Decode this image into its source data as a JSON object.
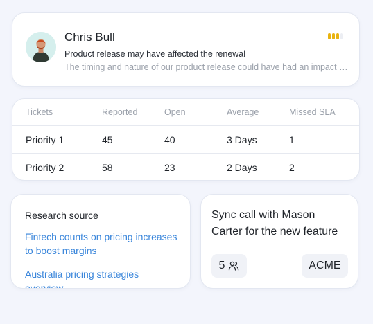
{
  "person": {
    "name": "Chris Bull",
    "note_title": "Product release may have affected the renewal",
    "note_body": "The timing and nature of our product release could have had an impact on the renewal",
    "signal_level": 3,
    "signal_max": 4,
    "signal_color": "#e9b30f",
    "avatar_icon": "avatar-photo"
  },
  "tickets": {
    "headers": [
      "Tickets",
      "Reported",
      "Open",
      "Average",
      "Missed SLA"
    ],
    "rows": [
      [
        "Priority 1",
        "45",
        "40",
        "3 Days",
        "1"
      ],
      [
        "Priority 2",
        "58",
        "23",
        "2 Days",
        "2"
      ]
    ]
  },
  "research": {
    "title": "Research source",
    "links": [
      "Fintech counts on pricing increases to boost margins",
      "Australia pricing strategies overview"
    ],
    "link_color": "#3a86db"
  },
  "meeting": {
    "title_line1": "Sync call with Mason",
    "title_line2": "Carter for the new feature",
    "attendees": "5",
    "attendees_icon": "people-icon",
    "company": "ACME"
  }
}
